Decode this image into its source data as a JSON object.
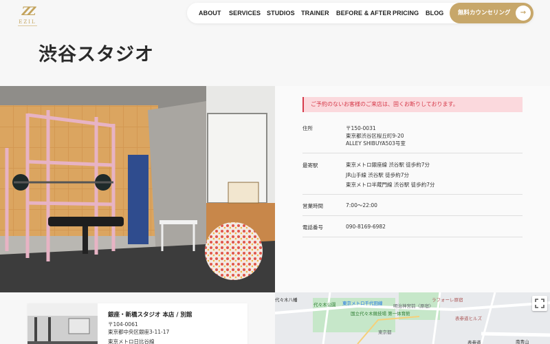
{
  "logo": {
    "mark": "ZZ",
    "text": "EZIL"
  },
  "nav": {
    "items": [
      "ABOUT",
      "SERVICES",
      "STUDIOS",
      "TRAINER",
      "BEFORE & AFTER",
      "PRICING",
      "BLOG"
    ],
    "cta_label": "無料カウンセリング",
    "cta_arrow": "→"
  },
  "page": {
    "title": "渋谷スタジオ"
  },
  "info": {
    "notice": "ご予約のないお客様のご来店は、固くお断りしております。",
    "address_label": "住所",
    "address_lines": [
      "〒150-0031",
      "東京都渋谷区桜丘町9-20",
      "ALLEY SHIBUYA503号室"
    ],
    "station_label": "最寄駅",
    "station_lines": [
      "東京メトロ銀座線 渋谷駅 徒歩約7分",
      "JR山手線 渋谷駅 徒歩約7分",
      "東京メトロ半蔵門線 渋谷駅 徒歩約7分"
    ],
    "hours_label": "営業時間",
    "hours_value": "7:00〜22:00",
    "phone_label": "電話番号",
    "phone_value": "090-8169-6982"
  },
  "card": {
    "title": "銀座・新橋スタジオ 本店 / 別館",
    "lines": [
      "〒104-0061",
      "東京都中央区銀座3-11-17",
      "東京メトロ日比谷線"
    ]
  },
  "map": {
    "labels": [
      "代々木八幡",
      "代々木公園",
      "東京メトロ千代田線",
      "明治神宮前〈原宿〉",
      "ラフォーレ原宿",
      "国立代々木競技場 第一体育館",
      "表参道ヒルズ",
      "表参道",
      "南青山",
      "東京都"
    ]
  },
  "colors": {
    "accent": "#c7a76a",
    "notice": "#d63a4a",
    "notice_bg": "#fbd9dd"
  }
}
